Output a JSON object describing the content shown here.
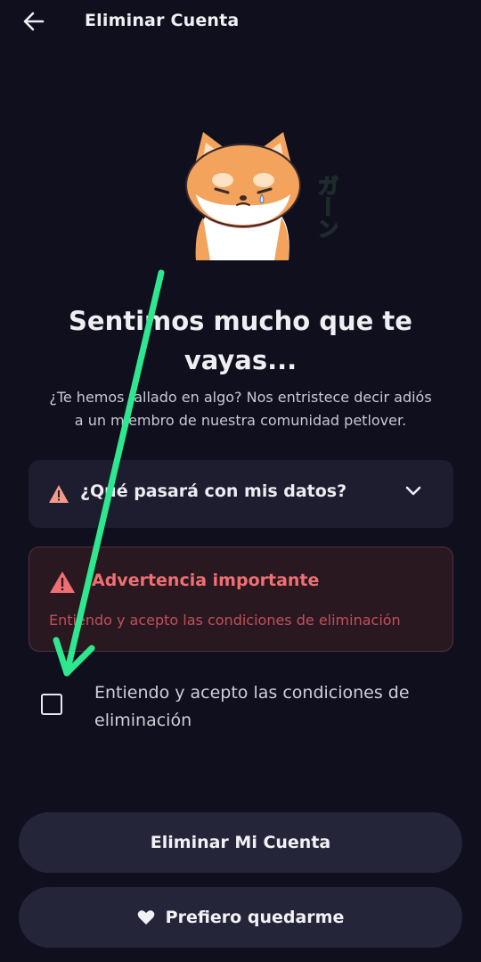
{
  "header": {
    "title": "Eliminar Cuenta",
    "back_icon": "arrow-left-icon"
  },
  "mascot": {
    "icon": "sad-shiba-dog-icon",
    "text": "ガーン"
  },
  "content": {
    "headline_line1": "Sentimos mucho que te",
    "headline_line2": "vayas...",
    "subtitle_line1": "¿Te hemos fallado en algo? Nos entristece decir adiós",
    "subtitle_line2": "a un miembro de nuestra comunidad petlover."
  },
  "data_section": {
    "label": "¿Qué pasará con mis datos?",
    "expanded": false,
    "icon": "warning-triangle-icon"
  },
  "warning": {
    "title": "Advertencia importante",
    "body": "Entiendo y acepto las condiciones de eliminación",
    "icon": "warning-triangle-icon"
  },
  "confirm": {
    "checked": false,
    "label_line1": "Entiendo y acepto las condiciones de",
    "label_line2": "eliminación"
  },
  "buttons": {
    "delete_label": "Eliminar Mi Cuenta",
    "stay_label": "Prefiero quedarme",
    "stay_icon": "heart-icon"
  },
  "colors": {
    "background": "#0f0f1e",
    "card": "#1d1d2f",
    "warning_accent": "#f06f73",
    "annotation_arrow": "#2ee88f"
  }
}
